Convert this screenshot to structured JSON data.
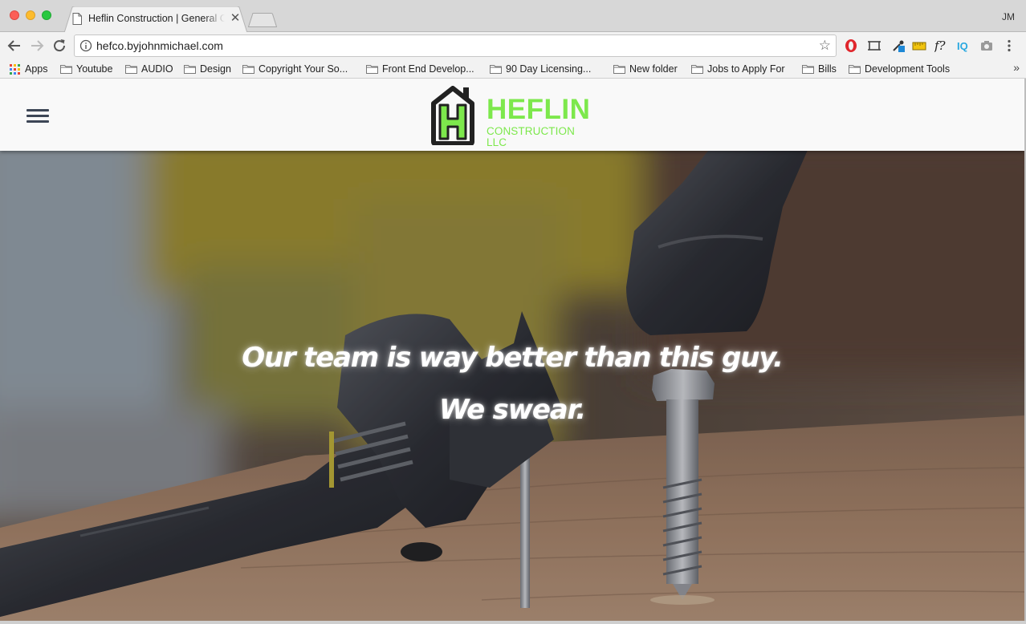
{
  "browser": {
    "tab_title": "Heflin Construction | General Contractor",
    "url": "hefco.byjohnmichael.com",
    "profile": "JM",
    "bookmarks": [
      {
        "label": "Apps",
        "icon": "apps-grid-icon"
      },
      {
        "label": "Youtube",
        "icon": "folder-icon"
      },
      {
        "label": "AUDIO",
        "icon": "folder-icon"
      },
      {
        "label": "Design",
        "icon": "folder-icon"
      },
      {
        "label": "Copyright Your So...",
        "icon": "folder-icon"
      },
      {
        "label": "Front End Develop...",
        "icon": "folder-icon"
      },
      {
        "label": "90 Day Licensing...",
        "icon": "folder-icon"
      },
      {
        "label": "New folder",
        "icon": "folder-icon"
      },
      {
        "label": "Jobs to Apply For",
        "icon": "folder-icon"
      },
      {
        "label": "Bills",
        "icon": "folder-icon"
      },
      {
        "label": "Development Tools",
        "icon": "folder-icon"
      }
    ],
    "overflow_label": "»"
  },
  "site": {
    "logo_word": "HEFLIN",
    "logo_sub": "CONSTRUCTION LLC",
    "brand_color": "#7de84c",
    "nav_icon": "hamburger-menu-icon"
  },
  "hero": {
    "line1": "Our team is way better than this guy.",
    "line2": "We swear."
  }
}
